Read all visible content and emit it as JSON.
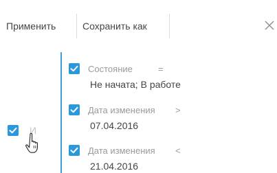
{
  "toolbar": {
    "apply_label": "Применить",
    "save_as_label": "Сохранить как",
    "close_icon": "close-icon"
  },
  "group": {
    "checked": true,
    "operator_label": "И"
  },
  "conditions": [
    {
      "checked": true,
      "column": "Состояние",
      "operator": "=",
      "value": "Не начата; В работе"
    },
    {
      "checked": true,
      "column": "Дата изменения",
      "operator": ">",
      "value": "07.04.2016"
    },
    {
      "checked": true,
      "column": "Дата изменения",
      "operator": "<",
      "value": "21.04.2016"
    }
  ],
  "colors": {
    "accent": "#2b98dc",
    "group_bar": "#3aa0dd"
  }
}
